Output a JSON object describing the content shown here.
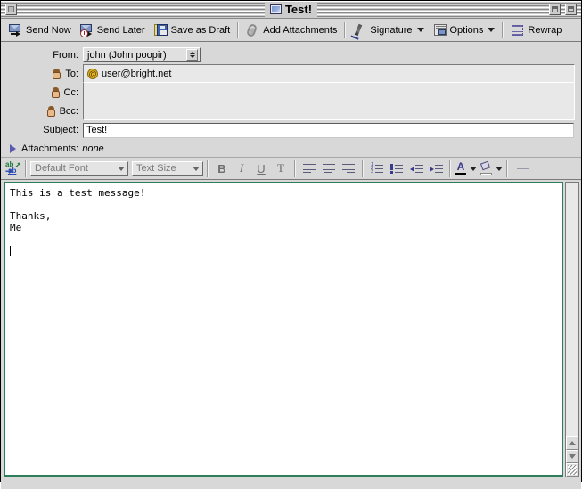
{
  "window": {
    "title": "Test!",
    "title_icon": "message-document-icon",
    "close_box": "close-box",
    "zoom_box": "zoom-box",
    "collapse_box": "collapse-box"
  },
  "toolbar": {
    "items": [
      {
        "label": "Send Now",
        "icon": "send-now-icon",
        "dropdown": false
      },
      {
        "label": "Send Later",
        "icon": "send-later-icon",
        "dropdown": false
      },
      {
        "label": "Save as Draft",
        "icon": "save-draft-icon",
        "dropdown": false
      },
      {
        "label": "Add Attachments",
        "icon": "paperclip-icon",
        "dropdown": false
      },
      {
        "label": "Signature",
        "icon": "signature-pen-icon",
        "dropdown": true
      },
      {
        "label": "Options",
        "icon": "options-icon",
        "dropdown": true
      },
      {
        "label": "Rewrap",
        "icon": "rewrap-icon",
        "dropdown": false
      }
    ]
  },
  "headers": {
    "from_label": "From:",
    "from_value": "john (John poopir)",
    "to_label": "To:",
    "to_value": "user@bright.net",
    "cc_label": "Cc:",
    "cc_value": "",
    "bcc_label": "Bcc:",
    "bcc_value": "",
    "subject_label": "Subject:",
    "subject_value": "Test!",
    "attachments_label": "Attachments:",
    "attachments_value": "none"
  },
  "formatbar": {
    "spell_icon": "spell-check-icon",
    "font_value": "Default Font",
    "size_value": "Text Size",
    "bold_label": "B",
    "italic_label": "I",
    "underline_label": "U",
    "teletype_label": "T",
    "align_left": "align-left-icon",
    "align_center": "align-center-icon",
    "align_right": "align-right-icon",
    "numbered_list": "numbered-list-icon",
    "bulleted_list": "bulleted-list-icon",
    "outdent": "outdent-icon",
    "indent": "indent-icon",
    "text_color_label": "A",
    "text_color": "#000000",
    "highlight_color": "#ffffff"
  },
  "body": {
    "line1": "This is a test message!",
    "line2": "",
    "line3": "Thanks,",
    "line4": "Me",
    "line5": ""
  },
  "scrollbar": {
    "up_arrow": "scroll-up-arrow",
    "down_arrow": "scroll-down-arrow",
    "resize_grip": "resize-grip"
  },
  "colors": {
    "window_chrome": "#d8d8d8",
    "body_border": "#2e7d5b",
    "at_icon": "#e8b820"
  }
}
